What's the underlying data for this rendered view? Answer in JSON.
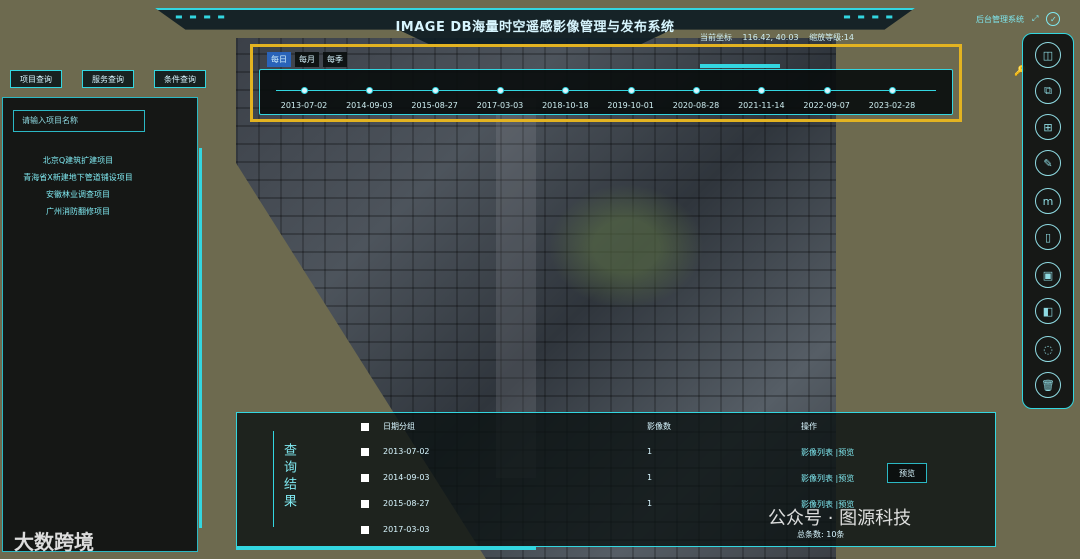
{
  "title": "IMAGE DB海量时空遥感影像管理与发布系统",
  "coords": {
    "label": "当前坐标",
    "value": "116.42, 40.03",
    "zoom_label": "缩放等级:14"
  },
  "top_right": {
    "label": "后台管理系统"
  },
  "search_tabs": [
    "项目查询",
    "服务查询",
    "条件查询"
  ],
  "left_panel": {
    "search_placeholder": "请输入项目名称",
    "items": [
      "北京Q建筑扩建项目",
      "青海省X新建地下管道铺设项目",
      "安徽林业调查项目",
      "广州消防翻修项目"
    ]
  },
  "timeline": {
    "tabs": [
      "每日",
      "每月",
      "每季"
    ],
    "active_tab": "每日",
    "dates": [
      "2013-07-02",
      "2014-09-03",
      "2015-08-27",
      "2017-03-03",
      "2018-10-18",
      "2019-10-01",
      "2020-08-28",
      "2021-11-14",
      "2022-09-07",
      "2023-02-28"
    ]
  },
  "right_toolbar": [
    "layers-icon",
    "copy-icon",
    "grid-icon",
    "ruler-icon",
    "measure-icon",
    "trash-icon",
    "image-icon",
    "split-icon",
    "loading-icon",
    "delete-icon"
  ],
  "results": {
    "vertical_title": "查询结果",
    "headers": {
      "date": "日期分组",
      "count": "影像数",
      "ops": "操作"
    },
    "rows": [
      {
        "date": "2013-07-02",
        "count": "1"
      },
      {
        "date": "2014-09-03",
        "count": "1"
      },
      {
        "date": "2015-08-27",
        "count": "1"
      },
      {
        "date": "2017-03-03",
        "count": ""
      }
    ],
    "ops": [
      "影像列表 |预览",
      "影像列表 |预览",
      "影像列表 |预览"
    ],
    "preview_label": "预览",
    "total": "总条数: 10条"
  },
  "watermark": {
    "left": "大数跨境",
    "right": "公众号 · 图源科技"
  },
  "colors": {
    "accent": "#33d6e0",
    "highlight": "#e3b321",
    "tab_active": "#2a63b8"
  }
}
